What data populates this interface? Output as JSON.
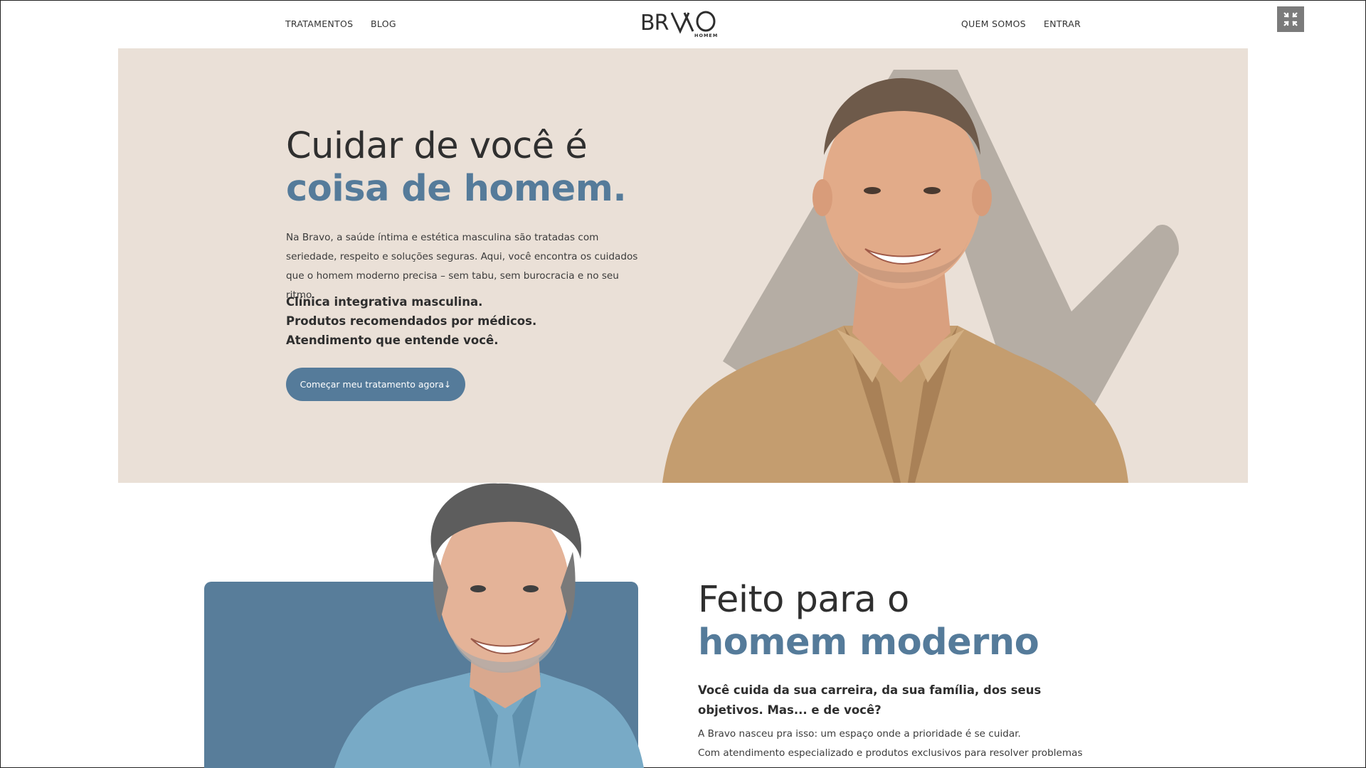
{
  "nav": {
    "left_links": [
      "TRATAMENTOS",
      "BLOG"
    ],
    "right_links": [
      "QUEM SOMOS",
      "ENTRAR"
    ],
    "logo_text": "BRAVO",
    "logo_sub": "HOMEM"
  },
  "hero": {
    "title_line1": "Cuidar de você é",
    "title_line2": "coisa de homem.",
    "description": "Na Bravo, a saúde íntima e estética masculina são tratadas com seriedade, respeito e soluções seguras. Aqui, você encontra os cuidados que o homem moderno precisa – sem tabu, sem burocracia e no seu ritmo.",
    "bullets": [
      "Clínica integrativa masculina.",
      "Produtos recomendados por médicos.",
      "Atendimento que entende você."
    ],
    "cta_label": "Começar meu tratamento agora↓"
  },
  "section2": {
    "title_line1": "Feito para o",
    "title_line2": "homem moderno",
    "lead": "Você cuida da sua carreira, da sua família, dos seus objetivos. Mas... e de você?",
    "paragraph_line1": "A Bravo nasceu pra isso: um espaço onde a prioridade é se cuidar.",
    "paragraph_line2": "Com atendimento especializado e produtos exclusivos para resolver problemas"
  },
  "colors": {
    "accent": "#557b9a",
    "hero_bg": "#eae0d7",
    "panel_blue": "#587d9a"
  },
  "icons": {
    "fullscreen": "exit-fullscreen-icon"
  }
}
